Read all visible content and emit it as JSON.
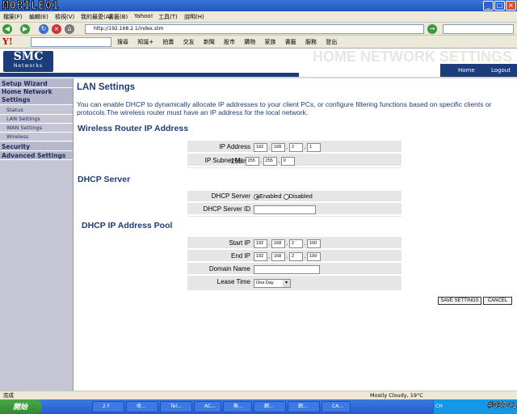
{
  "watermark_top": "MOBILE01",
  "watermark_bottom": "#83741",
  "menu": [
    "檔案(F)",
    "編輯(E)",
    "檢視(V)",
    "我的最愛(A)",
    "書籤(B)",
    "Yahoo!",
    "工具(T)",
    "說明(H)"
  ],
  "address": "http://192.168.2.1/index.stm",
  "search_placeholder": "",
  "yahoo_links": [
    "搜尋",
    "知識+",
    "拍賣",
    "交友",
    "新聞",
    "股市",
    "購物",
    "家族",
    "書籤",
    "服務",
    "登出"
  ],
  "brand": {
    "logo": "SMC",
    "logo_sub": "Networks",
    "banner": "HOME NETWORK SETTINGS"
  },
  "home_bar": {
    "home": "Home",
    "logout": "Logout"
  },
  "sidebar": [
    {
      "label": "Setup Wizard",
      "type": "main"
    },
    {
      "label": "Home Network Settings",
      "type": "main"
    },
    {
      "label": "Status",
      "type": "sub"
    },
    {
      "label": "LAN Settings",
      "type": "sub"
    },
    {
      "label": "WAN Settings",
      "type": "sub"
    },
    {
      "label": "Wireless",
      "type": "sub"
    },
    {
      "label": "Security",
      "type": "main"
    },
    {
      "label": "Advanced Settings",
      "type": "main"
    }
  ],
  "page_title": "LAN Settings",
  "intro": "You can enable DHCP to dynamically allocate IP addresses to your client PCs, or configure filtering functions based on specific clients or protocols.The wireless router must have an IP address for the local network.",
  "wireless": {
    "heading": "Wireless Router IP Address",
    "ip_label": "IP Address",
    "ip": [
      "192",
      "168",
      "2",
      "1"
    ],
    "mask_label": "IP Subnet Mask",
    "mask_prefix": "255.",
    "mask": [
      "255",
      "255",
      "0"
    ]
  },
  "dhcp": {
    "heading": "DHCP Server",
    "server_label": "DHCP Server",
    "enabled": "Enabled",
    "disabled": "Disabled",
    "server_id_label": "DHCP Server ID",
    "server_id": ""
  },
  "pool": {
    "heading": "DHCP IP Address Pool",
    "start_label": "Start IP",
    "start": [
      "192",
      "168",
      "2",
      "100"
    ],
    "end_label": "End IP",
    "end": [
      "192",
      "168",
      "2",
      "199"
    ],
    "domain_label": "Domain Name",
    "domain": "",
    "lease_label": "Lease Time",
    "lease": "One Day"
  },
  "buttons": {
    "save": "SAVE SETTINGS",
    "cancel": "CANCEL"
  },
  "status": {
    "left": "完成",
    "right": "Mostly Cloudy, 19°C"
  },
  "taskbar": {
    "start": "開始",
    "tasks": [
      "2 F",
      "收...",
      "Tel...",
      "AC...",
      "無...",
      "網...",
      "網...",
      "CA..."
    ],
    "clock": "CH"
  }
}
